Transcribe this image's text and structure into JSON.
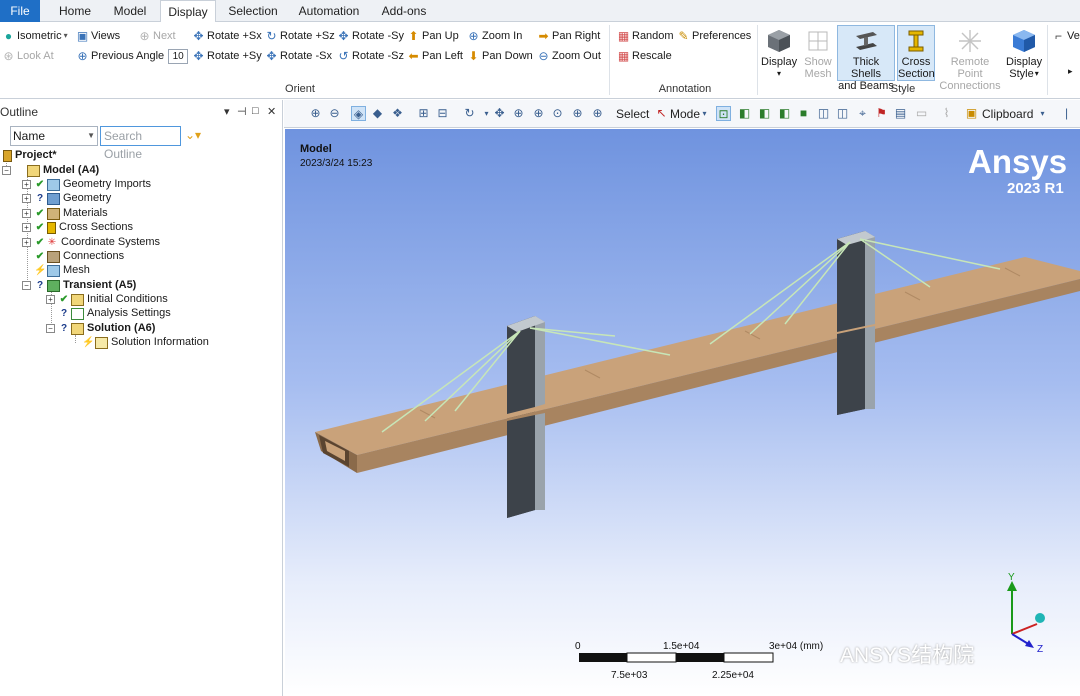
{
  "menu": {
    "file": "File",
    "home": "Home",
    "model": "Model",
    "display": "Display",
    "selection": "Selection",
    "automation": "Automation",
    "addons": "Add-ons"
  },
  "ribbon": {
    "orient": {
      "label": "Orient",
      "isometric": "Isometric",
      "views": "Views",
      "next": "Next",
      "look_at": "Look At",
      "previous": "Previous",
      "angle_label": "Angle",
      "angle_value": "10",
      "rotate_px": "Rotate +Sx",
      "rotate_py": "Rotate +Sy",
      "rotate_pz": "Rotate +Sz",
      "rotate_mx": "Rotate -Sx",
      "rotate_my": "Rotate -Sy",
      "rotate_mz": "Rotate -Sz",
      "pan_up": "Pan Up",
      "pan_left": "Pan Left",
      "zoom_in": "Zoom In",
      "pan_down": "Pan Down",
      "pan_right": "Pan Right",
      "zoom_out": "Zoom Out"
    },
    "annotation": {
      "label": "Annotation",
      "random": "Random",
      "preferences": "Preferences",
      "rescale": "Rescale"
    },
    "style": {
      "label": "Style",
      "display": "Display",
      "show_mesh_1": "Show",
      "show_mesh_2": "Mesh",
      "thick_1": "Thick Shells",
      "thick_2": "and Beams",
      "cross_1": "Cross",
      "cross_2": "Section",
      "remote_1": "Remote Point",
      "remote_2": "Connections",
      "dstyle_1": "Display",
      "dstyle_2": "Style"
    },
    "vertex": "Vertex"
  },
  "outline": {
    "title": "Outline",
    "name_combo": "Name",
    "search_placeholder": "Search Outline",
    "tree": {
      "project": "Project*",
      "model": "Model (A4)",
      "geometry_imports": "Geometry Imports",
      "geometry": "Geometry",
      "materials": "Materials",
      "cross_sections": "Cross Sections",
      "coordinate_systems": "Coordinate Systems",
      "connections": "Connections",
      "mesh": "Mesh",
      "transient": "Transient (A5)",
      "initial_conditions": "Initial Conditions",
      "analysis_settings": "Analysis Settings",
      "solution": "Solution (A6)",
      "solution_information": "Solution Information"
    }
  },
  "viewport_toolbar": {
    "select": "Select",
    "mode": "Mode",
    "clipboard": "Clipboard"
  },
  "viewport": {
    "model_label": "Model",
    "date": "2023/3/24 15:23",
    "brand": "Ansys",
    "version": "2023 R1",
    "scale": {
      "t0": "0",
      "t1": "1.5e+04",
      "t2": "3e+04 (mm)",
      "b1": "7.5e+03",
      "b2": "2.25e+04"
    },
    "triad": {
      "y": "Y",
      "z": "Z"
    },
    "watermark": "ANSYS结构院"
  },
  "colors": {
    "deck": "#c9a27a",
    "tower": "#3e444b",
    "cable": "#c7e6b8",
    "accent": "#1f6fc6"
  }
}
